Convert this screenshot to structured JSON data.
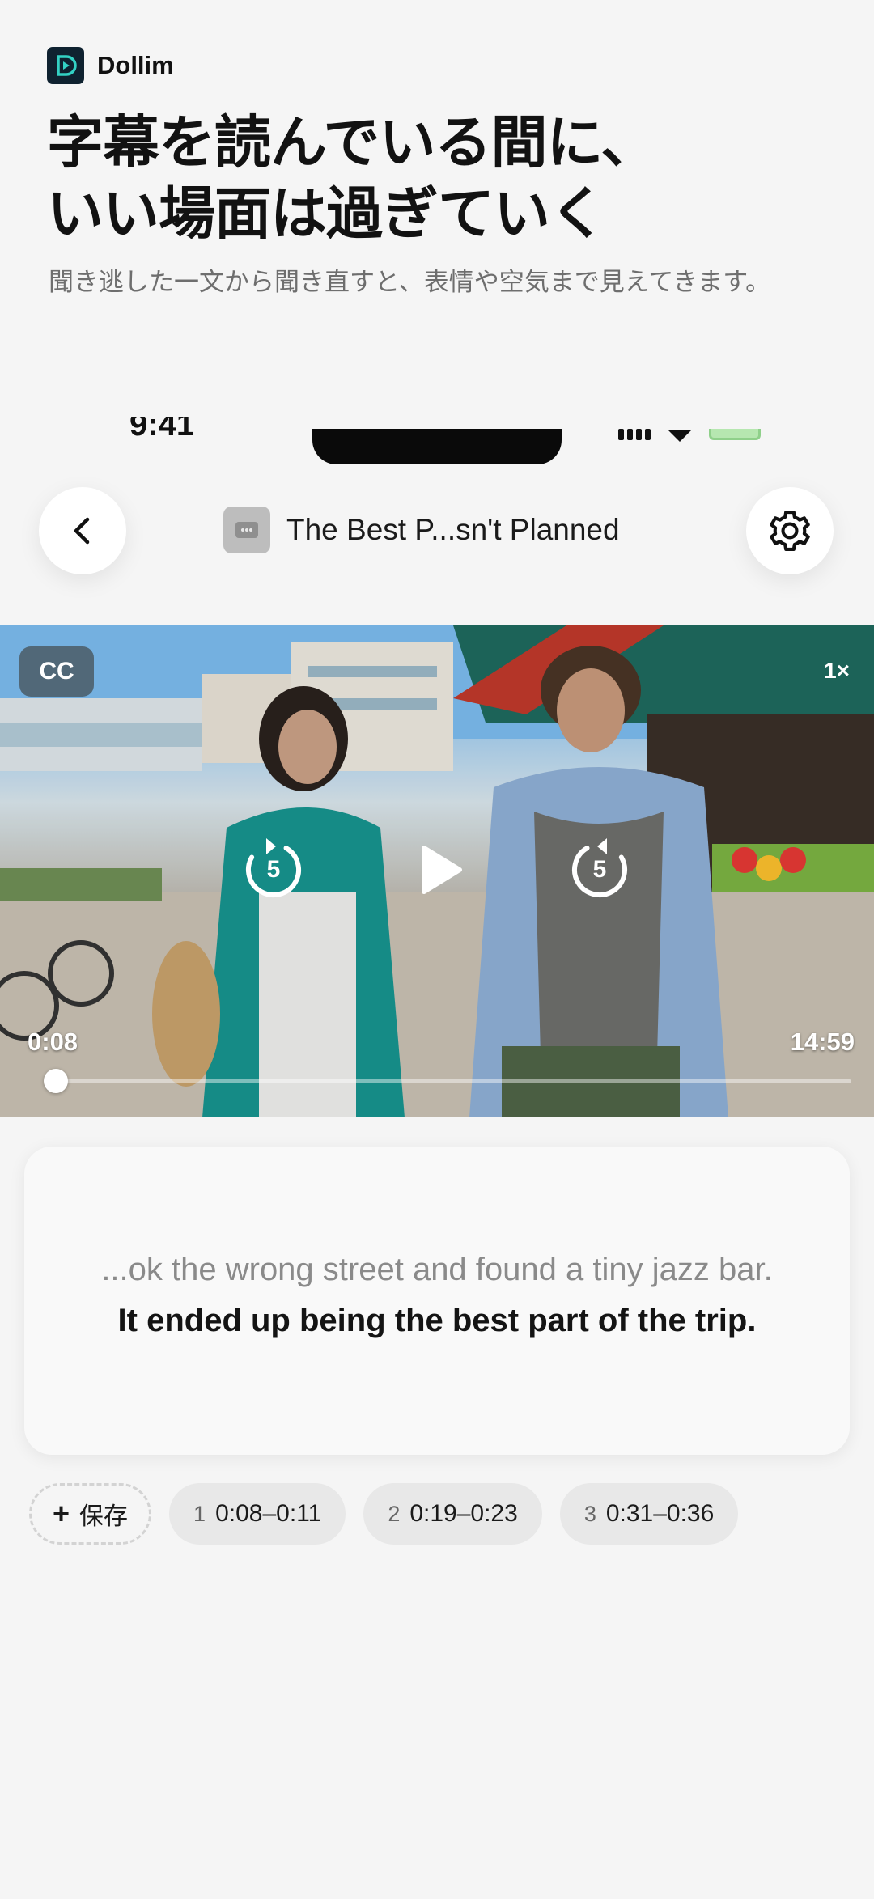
{
  "brand": {
    "name": "Dollim"
  },
  "hero": {
    "headline_line1": "字幕を読んでいる間に、",
    "headline_line2": "いい場面は過ぎていく",
    "subline": "聞き逃した一文から聞き直すと、表情や空気まで見えてきます。"
  },
  "status_bar": {
    "time": "9:41"
  },
  "nav": {
    "title": "The Best P...sn't Planned"
  },
  "player": {
    "cc_label": "CC",
    "speed": "1×",
    "rewind_seconds": "5",
    "forward_seconds": "5",
    "current_time": "0:08",
    "duration": "14:59",
    "progress_fraction": 0.009
  },
  "subtitle": {
    "previous_line": "...ok the wrong street and found a tiny jazz bar.",
    "current_line": "It ended up being the best part of the trip."
  },
  "clips": {
    "save_label": "保存",
    "items": [
      {
        "index": "1",
        "range": "0:08–0:11"
      },
      {
        "index": "2",
        "range": "0:19–0:23"
      },
      {
        "index": "3",
        "range": "0:31–0:36"
      }
    ]
  },
  "colors": {
    "brand_dark": "#0f2230",
    "brand_accent": "#33d1c4",
    "background": "#f5f5f5"
  }
}
